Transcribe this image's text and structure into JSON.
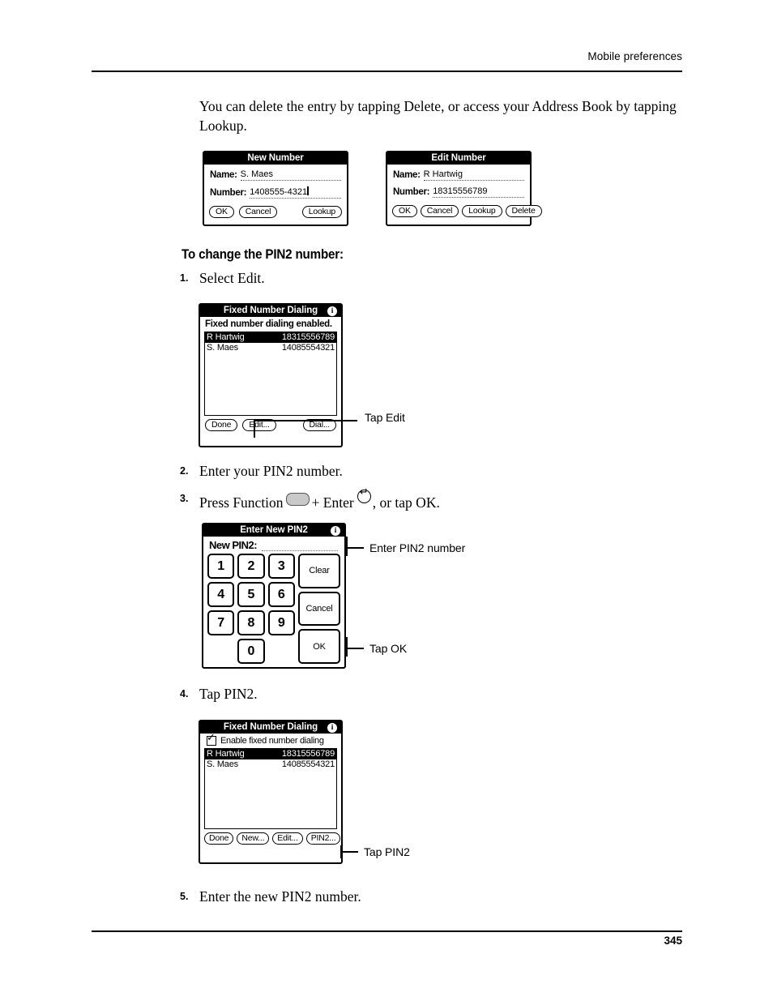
{
  "page": {
    "header_title": "Mobile preferences",
    "page_number": "345"
  },
  "intro_paragraph": "You can delete the entry by tapping Delete, or access your Address Book by tapping Lookup.",
  "section": {
    "heading": "To change the PIN2 number:"
  },
  "steps": [
    {
      "num": "1.",
      "text": "Select Edit."
    },
    {
      "num": "2.",
      "text": "Enter your PIN2 number."
    },
    {
      "num": "3.",
      "text_before": "Press Function",
      "text_middle": "+ Enter",
      "text_after": ", or tap OK."
    },
    {
      "num": "4.",
      "text": "Tap PIN2."
    },
    {
      "num": "5.",
      "text": "Enter the new PIN2 number."
    }
  ],
  "new_number_dialog": {
    "title": "New Number",
    "name_label": "Name:",
    "name_value": "S. Maes",
    "number_label": "Number:",
    "number_value": "1408555-4321",
    "buttons": [
      "OK",
      "Cancel",
      "Lookup"
    ]
  },
  "edit_number_dialog": {
    "title": "Edit Number",
    "name_label": "Name:",
    "name_value": "R Hartwig",
    "number_label": "Number:",
    "number_value": "18315556789",
    "buttons": [
      "OK",
      "Cancel",
      "Lookup",
      "Delete"
    ]
  },
  "fnd_screen_1": {
    "title": "Fixed Number Dialing",
    "info_icon": "info-icon",
    "status_text": "Fixed number dialing enabled.",
    "entries": [
      {
        "name": "R Hartwig",
        "number": "18315556789",
        "selected": true
      },
      {
        "name": "S. Maes",
        "number": "14085554321",
        "selected": false
      }
    ],
    "buttons": [
      "Done",
      "Edit...",
      "Dial..."
    ],
    "callout": "Tap Edit"
  },
  "pin_dialog": {
    "title": "Enter New PIN2",
    "info_icon": "info-icon",
    "field_label": "New PIN2:",
    "field_value": "",
    "keys": [
      "1",
      "2",
      "3",
      "4",
      "5",
      "6",
      "7",
      "8",
      "9",
      "0"
    ],
    "action_keys": [
      "Clear",
      "Cancel",
      "OK"
    ],
    "callout_top": "Enter PIN2 number",
    "callout_bottom": "Tap OK"
  },
  "fnd_screen_2": {
    "title": "Fixed Number Dialing",
    "info_icon": "info-icon",
    "checkbox_label": "Enable fixed number dialing",
    "checkbox_checked": true,
    "entries": [
      {
        "name": "R Hartwig",
        "number": "18315556789",
        "selected": true
      },
      {
        "name": "S. Maes",
        "number": "14085554321",
        "selected": false
      }
    ],
    "buttons": [
      "Done",
      "New...",
      "Edit...",
      "PIN2..."
    ],
    "callout": "Tap PIN2"
  }
}
